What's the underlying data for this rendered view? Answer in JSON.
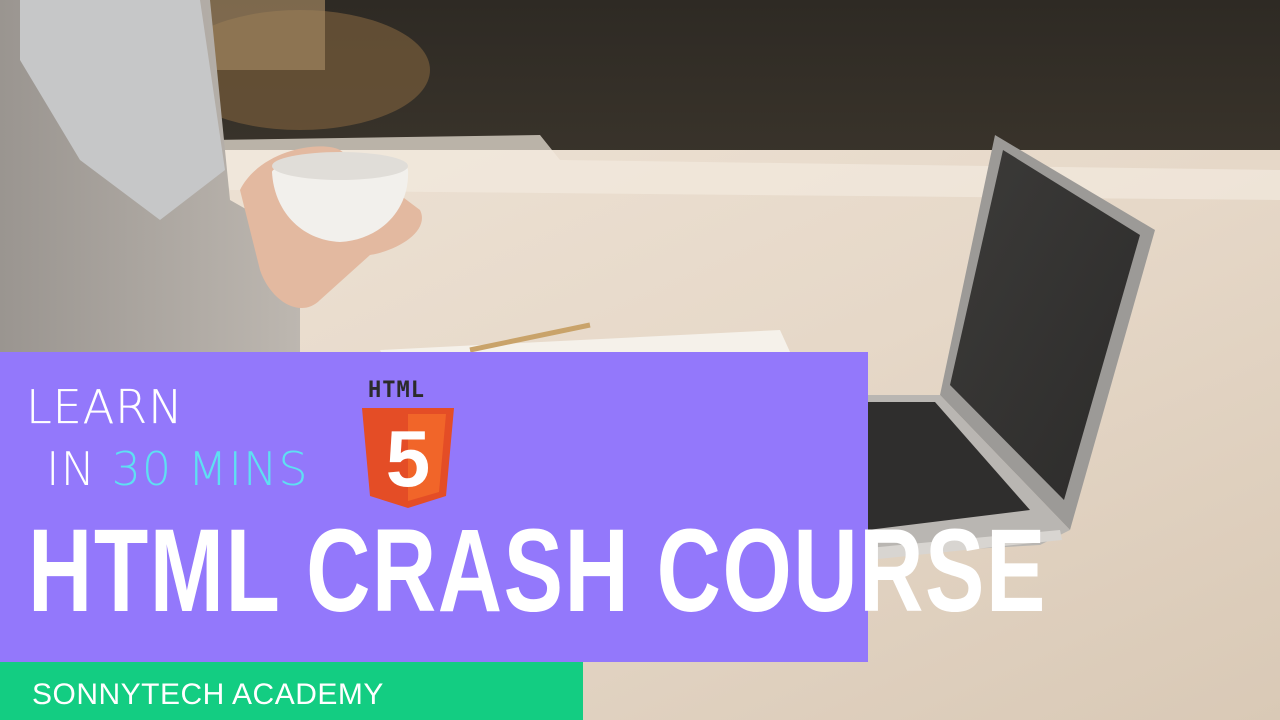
{
  "thumbnail": {
    "learn_line": "LEARN",
    "in_word": "IN",
    "duration": "30 MINS",
    "html_badge_text": "HTML",
    "html5_digit": "5",
    "title": "HTML CRASH COURSE",
    "channel": "SONNYTECH ACADEMY"
  },
  "colors": {
    "panel_purple": "#9378fb",
    "highlight_cyan": "#5ee0f2",
    "channel_green": "#13cd82",
    "html5_orange": "#e44d26"
  },
  "icons": [
    "html5-logo-icon"
  ]
}
